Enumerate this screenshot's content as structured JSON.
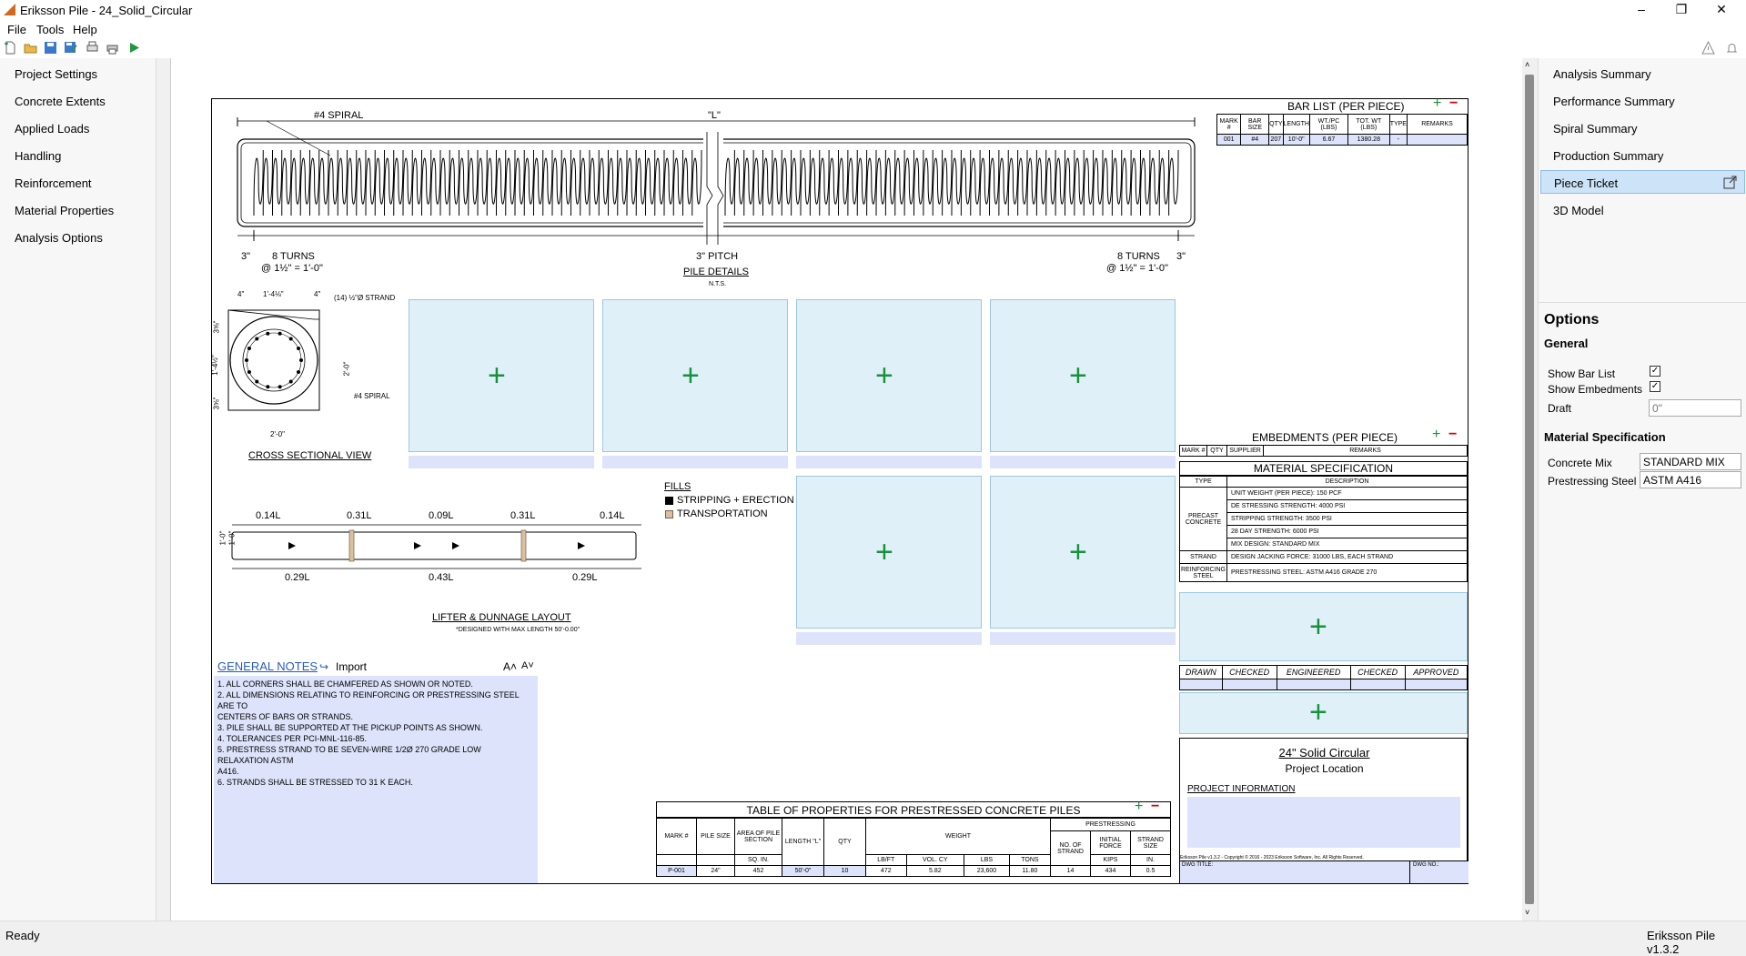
{
  "window": {
    "title": "Eriksson Pile - 24_Solid_Circular",
    "minimize": "–",
    "restore": "❐",
    "close": "✕"
  },
  "menu": {
    "file": "File",
    "tools": "Tools",
    "help": "Help"
  },
  "left_nav": [
    "Project Settings",
    "Concrete Extents",
    "Applied Loads",
    "Handling",
    "Reinforcement",
    "Material Properties",
    "Analysis Options"
  ],
  "right_nav": [
    "Analysis Summary",
    "Performance Summary",
    "Spiral Summary",
    "Production Summary",
    "Piece Ticket",
    "3D Model"
  ],
  "options": {
    "heading": "Options",
    "general": "General",
    "show_bar_list": "Show Bar List",
    "show_embedments": "Show Embedments",
    "draft": "Draft",
    "draft_placeholder": "0\"",
    "material_spec": "Material Specification",
    "concrete_mix_label": "Concrete Mix",
    "concrete_mix": "STANDARD MIX",
    "prestressing_steel_label": "Prestressing Steel",
    "prestressing_steel": "ASTM A416"
  },
  "status": {
    "left": "Ready",
    "right": "Eriksson Pile v1.3.2"
  },
  "drawing": {
    "spiral_label": "#4 SPIRAL",
    "length_label": "\"L\"",
    "dim_3_left": "3\"",
    "turns_left": "8 TURNS",
    "turns_left_spacing": "@ 1½\" = 1'-0\"",
    "pitch": "3\" PITCH",
    "pile_details": "PILE DETAILS",
    "nts": "N.T.S.",
    "turns_right": "8 TURNS",
    "turns_right_spacing": "@ 1½\" = 1'-0\"",
    "dim_3_right": "3\"",
    "cs_top_4a": "4\"",
    "cs_top_mid": "1'-4⅛\"",
    "cs_top_4b": "4\"",
    "cs_strand": "(14) ½\"Ø STRAND",
    "cs_left_a": "3⅝\"",
    "cs_left_mid": "1'-4½\"",
    "cs_left_b": "3⅝\"",
    "cs_right": "2'-0\"",
    "cs_spiral": "#4 SPIRAL",
    "cs_bottom": "2'-0\"",
    "cross_section": "CROSS SECTIONAL VIEW",
    "lifter_top": [
      "0.14L",
      "0.31L",
      "0.09L",
      "0.31L",
      "0.14L"
    ],
    "lifter_bottom": [
      "0.29L",
      "0.43L",
      "0.29L"
    ],
    "lifter_height": "1'-0\"",
    "lifter_height2": "1'-0\"",
    "lifter_title": "LIFTER & DUNNAGE LAYOUT",
    "lifter_note": "*DESIGNED WITH MAX LENGTH 50'-0.00\"",
    "fills": "FILLS",
    "fill_stripping": "STRIPPING + ERECTION",
    "fill_transport": "TRANSPORTATION"
  },
  "notes": {
    "title": "GENERAL NOTES",
    "import": "Import",
    "font_up": "A˄",
    "font_down": "A˅",
    "lines": [
      "1. ALL CORNERS SHALL BE CHAMFERED AS SHOWN OR NOTED.",
      "2. ALL DIMENSIONS RELATING TO REINFORCING OR PRESTRESSING STEEL ARE TO",
      "CENTERS OF BARS OR STRANDS.",
      "3. PILE SHALL BE SUPPORTED AT THE PICKUP POINTS AS SHOWN.",
      "4. TOLERANCES PER PCI-MNL-116-85.",
      "5. PRESTRESS STRAND TO BE SEVEN-WIRE 1/2Ø 270 GRADE LOW RELAXATION ASTM",
      "A416.",
      "6. STRANDS SHALL BE STRESSED TO 31 K EACH."
    ]
  },
  "bar_list": {
    "title": "BAR LIST (PER PIECE)",
    "headers": [
      "MARK #",
      "BAR SIZE",
      "QTY",
      "LENGTH",
      "WT./PC (LBS)",
      "TOT. WT (LBS)",
      "TYPE",
      "REMARKS"
    ],
    "row": [
      "001",
      "#4",
      "207",
      "10'-0\"",
      "6.67",
      "1380.28",
      "-",
      ""
    ]
  },
  "embedments": {
    "title": "EMBEDMENTS (PER PIECE)",
    "headers": [
      "MARK #",
      "QTY",
      "SUPPLIER",
      "REMARKS"
    ]
  },
  "material_spec_table": {
    "title": "MATERIAL SPECIFICATION",
    "type_hdr": "TYPE",
    "desc_hdr": "DESCRIPTION",
    "precast": "PRECAST CONCRETE",
    "strand": "STRAND",
    "reinforcing": "REINFORCING STEEL",
    "rows": [
      "UNIT WEIGHT (PER PIECE): 150 PCF",
      "DE STRESSING STRENGTH: 4000 PSI",
      "STRIPPING STRENGTH: 3500 PSI",
      "28 DAY STRENGTH: 6000 PSI",
      "MIX DESIGN: STANDARD MIX"
    ],
    "strand_row": "DESIGN JACKING FORCE: 31000 LBS, EACH STRAND",
    "reinf_row": "PRESTRESSING STEEL: ASTM A416 GRADE 270"
  },
  "signoff": [
    "DRAWN",
    "CHECKED",
    "ENGINEERED",
    "CHECKED",
    "APPROVED"
  ],
  "title_block": {
    "name": "24\" Solid Circular",
    "location": "Project Location",
    "project_info": "PROJECT INFORMATION",
    "copyright": "Eriksson Pile v1.3.2 - Copyright © 2016 - 2023 Eriksson Software, Inc. All Rights Reserved.",
    "dwg_title": "DWG TITLE:",
    "dwg_no": "DWG NO.:"
  },
  "props": {
    "title": "TABLE OF PROPERTIES FOR PRESTRESSED CONCRETE PILES",
    "mark": "MARK #",
    "pile_size": "PILE SIZE",
    "area": "AREA OF PILE SECTION",
    "length": "LENGTH \"L\"",
    "qty": "QTY",
    "weight": "WEIGHT",
    "prestressing": "PRESTRESSING",
    "no_strand": "NO. OF STRAND",
    "init_force": "INITIAL FORCE",
    "strand_size": "STRAND SIZE",
    "u_area": "SQ. IN.",
    "u_lbft": "LB/FT",
    "u_volcy": "VOL. CY",
    "u_lbs": "LBS",
    "u_tons": "TONS",
    "u_kips": "KIPS",
    "u_in": "IN.",
    "row": [
      "P-001",
      "24\"",
      "452",
      "50'-0\"",
      "10",
      "472",
      "5.82",
      "23,600",
      "11.80",
      "14",
      "434",
      "0.5"
    ]
  }
}
